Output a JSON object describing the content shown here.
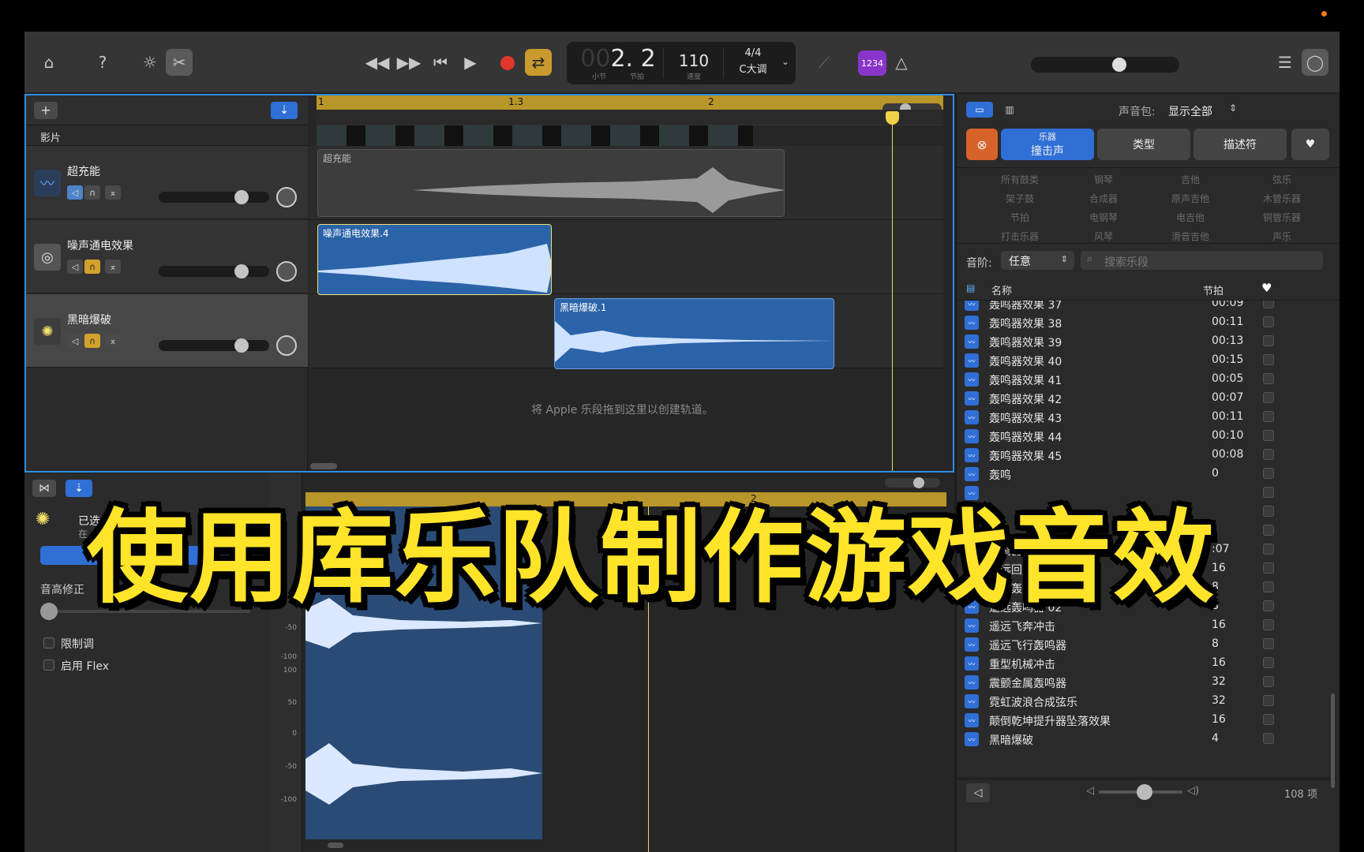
{
  "toolbar": {
    "lcd_bar_dim": "00",
    "lcd_position": "2. 2",
    "lcd_bar_label": "小节",
    "lcd_beat_label": "节拍",
    "tempo": "110",
    "tempo_label": "速度",
    "time_signature": "4/4",
    "key": "C大调",
    "count_in_badge": "1234"
  },
  "tracks": {
    "add_symbol": "+",
    "movie_label": "影片",
    "ruler": {
      "mark_1": "1",
      "mark_13": "1.3",
      "mark_2": "2"
    },
    "items": [
      {
        "name": "超充能"
      },
      {
        "name": "噪声通电效果"
      },
      {
        "name": "黑暗爆破"
      }
    ],
    "regions": {
      "r1": "超充能",
      "r2": "噪声通电效果.4",
      "r3": "黑暗爆破.1"
    },
    "drop_hint": "将 Apple 乐段拖到这里以创建轨道。"
  },
  "editor": {
    "track_name_partial": "已选",
    "track_sub_partial": "在",
    "pitch_label": "音高修正",
    "limit_label": "限制调",
    "flex_label": "启用 Flex",
    "ruler_mark": "2",
    "db_top": [
      "0",
      "-50",
      "-100"
    ],
    "db_bottom": [
      "100",
      "50",
      "0",
      "-50",
      "-100"
    ]
  },
  "library": {
    "soundpack_label": "声音包:",
    "soundpack_value": "显示全部",
    "tab_instrument_top": "乐器",
    "tab_instrument_bottom": "撞击声",
    "tab_genre": "类型",
    "tab_descriptor": "描述符",
    "categories": [
      [
        "所有鼓类",
        "钢琴",
        "吉他",
        "弦乐"
      ],
      [
        "架子鼓",
        "合成器",
        "原声吉他",
        "木管乐器"
      ],
      [
        "节拍",
        "电钢琴",
        "电吉他",
        "铜管乐器"
      ],
      [
        "打击乐器",
        "风琴",
        "滑音吉他",
        "声乐"
      ]
    ],
    "scale_label": "音阶:",
    "scale_value": "任意",
    "search_placeholder": "搜索乐段",
    "col_name": "名称",
    "col_beats": "节拍",
    "rows": [
      {
        "name": "轰鸣器效果 37",
        "beats": "00:09"
      },
      {
        "name": "轰鸣器效果 38",
        "beats": "00:11"
      },
      {
        "name": "轰鸣器效果 39",
        "beats": "00:13"
      },
      {
        "name": "轰鸣器效果 40",
        "beats": "00:15"
      },
      {
        "name": "轰鸣器效果 41",
        "beats": "00:05"
      },
      {
        "name": "轰鸣器效果 42",
        "beats": "00:07"
      },
      {
        "name": "轰鸣器效果 43",
        "beats": "00:11"
      },
      {
        "name": "轰鸣器效果 44",
        "beats": "00:10"
      },
      {
        "name": "轰鸣器效果 45",
        "beats": "00:08"
      },
      {
        "name": "轰鸣",
        "beats": "0"
      },
      {
        "name": "",
        "beats": ""
      },
      {
        "name": "",
        "beats": ""
      },
      {
        "name": "",
        "beats": ""
      },
      {
        "name": "轰鸣器效",
        "beats": ":07"
      },
      {
        "name": "遥远回声轰鸣器",
        "beats": "16"
      },
      {
        "name": "遥远轰鸣器 01",
        "beats": "8"
      },
      {
        "name": "遥远轰鸣器 02",
        "beats": "8"
      },
      {
        "name": "遥远飞奔冲击",
        "beats": "16"
      },
      {
        "name": "遥远飞行轰鸣器",
        "beats": "8"
      },
      {
        "name": "重型机械冲击",
        "beats": "16"
      },
      {
        "name": "震颤金属轰鸣器",
        "beats": "32"
      },
      {
        "name": "霓虹波浪合成弦乐",
        "beats": "32"
      },
      {
        "name": "颠倒乾坤提升器坠落效果",
        "beats": "16"
      },
      {
        "name": "黑暗爆破",
        "beats": "4"
      }
    ],
    "item_count": "108 项"
  },
  "overlay_title": "使用库乐队制作游戏音效",
  "colors": {
    "accent_blue": "#2f8ee6",
    "region_blue": "#2b63a8",
    "ruler_gold": "#b99629",
    "record_red": "#e0362c",
    "title_yellow": "#ffe42a"
  }
}
